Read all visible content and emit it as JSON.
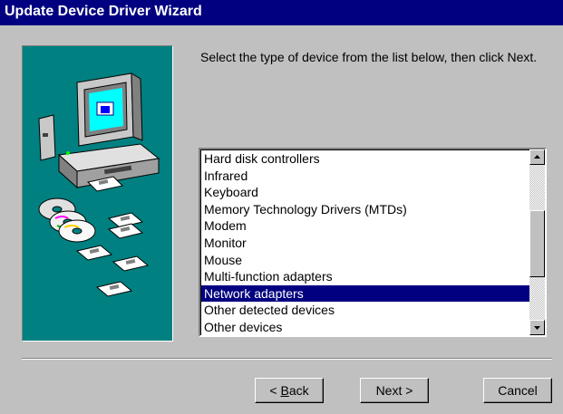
{
  "window": {
    "title": "Update Device Driver Wizard"
  },
  "instruction": "Select the type of device from the list below, then click Next.",
  "device_list": {
    "items": [
      "Hard disk controllers",
      "Infrared",
      "Keyboard",
      "Memory Technology Drivers (MTDs)",
      "Modem",
      "Monitor",
      "Mouse",
      "Multi-function adapters",
      "Network adapters",
      "Other detected devices",
      "Other devices"
    ],
    "selected": "Network adapters"
  },
  "buttons": {
    "back_prefix": "< ",
    "back_accel": "B",
    "back_rest": "ack",
    "next_label": "Next >",
    "cancel_label": "Cancel"
  },
  "icons": [
    "computer-icon",
    "cd-icon",
    "floppy-disk-icon",
    "scroll-up-icon",
    "scroll-down-icon"
  ],
  "colors": {
    "titlebar": "#000080",
    "art_bg": "#008080",
    "face": "#c0c0c0",
    "selection": "#000080"
  }
}
